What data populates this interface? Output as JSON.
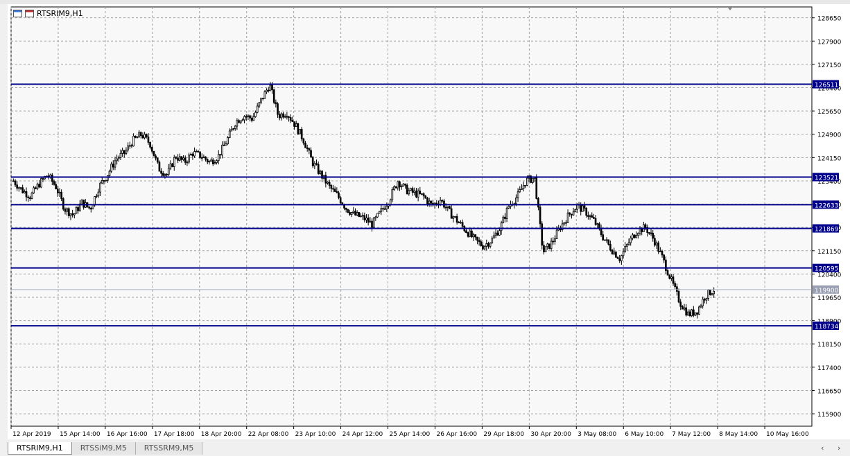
{
  "window": {
    "title": "RTSRIM9,H1"
  },
  "tabs": [
    {
      "label": "RTSRIM9,H1",
      "active": true
    },
    {
      "label": "RTSSiM9,M5",
      "active": false
    },
    {
      "label": "RTSSRM9,M5",
      "active": false
    }
  ],
  "scroll": {
    "left": "‹",
    "right": "›"
  },
  "colors": {
    "level_line": "#00008b",
    "grid": "#a0a0a0",
    "candle": "#000000",
    "bid_line": "#a7aec5"
  },
  "chart_data": {
    "type": "candlestick",
    "symbol": "RTSRIM9",
    "timeframe": "H1",
    "ylim": [
      115500,
      129000
    ],
    "price_ticks": [
      115900,
      116650,
      117400,
      118150,
      118900,
      119650,
      120400,
      121150,
      121900,
      122650,
      123400,
      124150,
      124900,
      125650,
      126400,
      127150,
      127900,
      128650
    ],
    "x_labels": [
      "12 Apr 2019",
      "15 Apr 14:00",
      "16 Apr 16:00",
      "17 Apr 18:00",
      "18 Apr 20:00",
      "22 Apr 08:00",
      "23 Apr 10:00",
      "24 Apr 12:00",
      "25 Apr 14:00",
      "26 Apr 16:00",
      "29 Apr 18:00",
      "30 Apr 20:00",
      "3 May 08:00",
      "6 May 10:00",
      "7 May 12:00",
      "8 May 14:00",
      "10 May 16:00"
    ],
    "levels": [
      {
        "label": "126511",
        "value": 126511
      },
      {
        "label": "123521",
        "value": 123521
      },
      {
        "label": "122633",
        "value": 122633
      },
      {
        "label": "121869",
        "value": 121869
      },
      {
        "label": "120595",
        "value": 120595
      },
      {
        "label": "118734",
        "value": 118734
      }
    ],
    "current_price": {
      "label": "119900",
      "value": 119900
    },
    "close_path": [
      123400,
      123100,
      122900,
      123300,
      123600,
      123200,
      122500,
      122300,
      122700,
      122500,
      123200,
      123600,
      124100,
      124300,
      124700,
      124900,
      124600,
      123800,
      123600,
      124200,
      124000,
      124300,
      124200,
      124000,
      124200,
      124700,
      125300,
      125500,
      125400,
      126000,
      126500,
      125500,
      125600,
      125200,
      124700,
      124000,
      123600,
      123200,
      122900,
      122500,
      122300,
      122200,
      122000,
      122400,
      122800,
      123400,
      123100,
      123000,
      122900,
      122600,
      122800,
      122400,
      122100,
      121800,
      121500,
      121300,
      121500,
      121900,
      122600,
      122900,
      123400,
      123500,
      121100,
      121400,
      121900,
      122300,
      122600,
      122400,
      122100,
      121600,
      121200,
      120900,
      121400,
      121800,
      121900,
      121500,
      120900,
      120200,
      119500,
      119100,
      119200,
      119700,
      119900
    ],
    "timestamps": [
      "12 Apr 2019",
      "15 Apr 14:00",
      "16 Apr 16:00",
      "17 Apr 18:00",
      "18 Apr 20:00",
      "22 Apr 08:00",
      "23 Apr 10:00",
      "24 Apr 12:00",
      "25 Apr 14:00",
      "26 Apr 16:00",
      "29 Apr 18:00",
      "30 Apr 20:00",
      "3 May 08:00",
      "6 May 10:00",
      "7 May 12:00",
      "8 May 14:00",
      "10 May 16:00"
    ]
  }
}
